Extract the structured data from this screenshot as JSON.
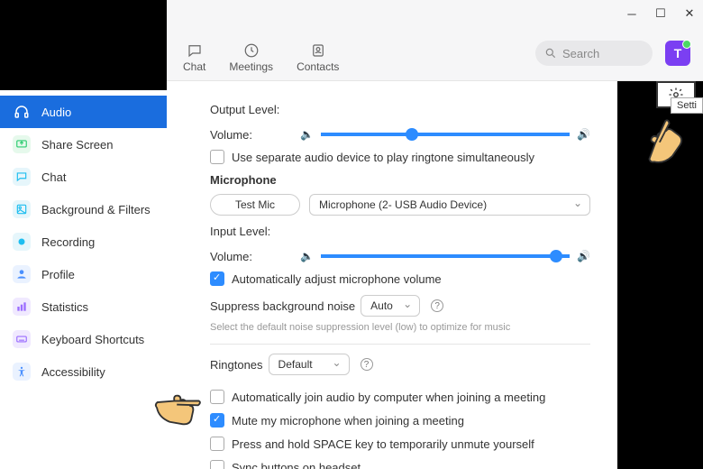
{
  "topnav": {
    "chat": "Chat",
    "meetings": "Meetings",
    "contacts": "Contacts"
  },
  "search": {
    "placeholder": "Search"
  },
  "avatar": {
    "initial": "T"
  },
  "tooltip": "Setti",
  "sidebar": {
    "items": [
      {
        "label": "Audio"
      },
      {
        "label": "Share Screen"
      },
      {
        "label": "Chat"
      },
      {
        "label": "Background & Filters"
      },
      {
        "label": "Recording"
      },
      {
        "label": "Profile"
      },
      {
        "label": "Statistics"
      },
      {
        "label": "Keyboard Shortcuts"
      },
      {
        "label": "Accessibility"
      }
    ]
  },
  "audio": {
    "output_level_label": "Output Level:",
    "volume_label": "Volume:",
    "speaker_slider_pct": 34,
    "separate_ringtone": "Use separate audio device to play ringtone simultaneously",
    "microphone_hdr": "Microphone",
    "test_mic": "Test Mic",
    "mic_device": "Microphone (2- USB Audio Device)",
    "input_level_label": "Input Level:",
    "mic_slider_pct": 92,
    "auto_adjust": "Automatically adjust microphone volume",
    "suppress_label": "Suppress background noise",
    "suppress_value": "Auto",
    "suppress_hint": "Select the default noise suppression level (low) to optimize for music",
    "ringtones_label": "Ringtones",
    "ringtones_value": "Default",
    "auto_join": "Automatically join audio by computer when joining a meeting",
    "mute_join": "Mute my microphone when joining a meeting",
    "space_unmute": "Press and hold SPACE key to temporarily unmute yourself",
    "sync_headset": "Sync buttons on headset"
  }
}
